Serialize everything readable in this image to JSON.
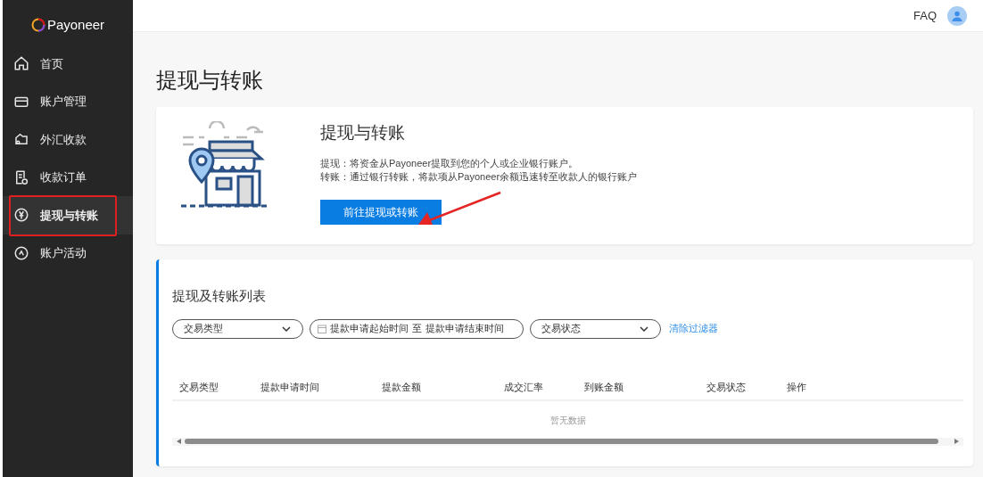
{
  "sidebar": {
    "logo": "Payoneer",
    "items": [
      {
        "label": "首页",
        "selected": false
      },
      {
        "label": "账户管理",
        "selected": false
      },
      {
        "label": "外汇收款",
        "selected": false
      },
      {
        "label": "收款订单",
        "selected": false
      },
      {
        "label": "提现与转账",
        "selected": true
      },
      {
        "label": "账户活动",
        "selected": false
      }
    ]
  },
  "header": {
    "faq": "FAQ"
  },
  "page_title": "提现与转账",
  "intro_card": {
    "title": "提现与转账",
    "lines": [
      "提现：将资金从Payoneer提取到您的个人或企业银行账户。",
      "转账：通过银行转账，将款项从Payoneer余额迅速转至收款人的银行账户"
    ],
    "button": "前往提现或转账"
  },
  "list": {
    "title": "提现及转账列表",
    "filters": [
      {
        "kind": "select",
        "label": "交易类型"
      },
      {
        "kind": "daterange",
        "start": "提款申请起始时间",
        "separator": "至",
        "end": "提款申请结束时间"
      },
      {
        "kind": "select",
        "label": "交易状态"
      }
    ],
    "clear": "清除过滤器",
    "columns": [
      "交易类型",
      "提款申请时间",
      "提款金额",
      "成交汇率",
      "到账金额",
      "交易状态",
      "操作"
    ],
    "empty": "暂无数据"
  }
}
